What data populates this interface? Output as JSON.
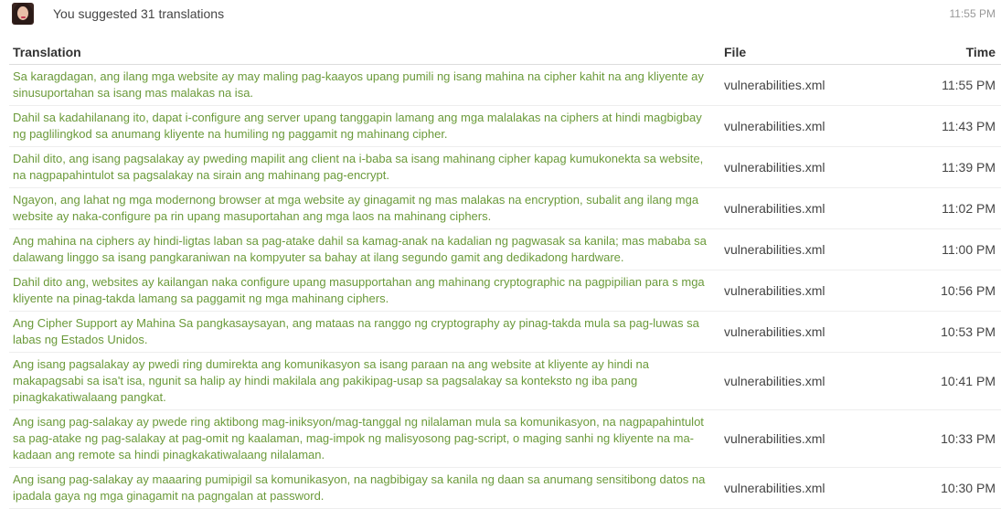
{
  "header": {
    "summary": "You suggested 31 translations",
    "time": "11:55 PM"
  },
  "table": {
    "columns": [
      "Translation",
      "File",
      "Time"
    ],
    "rows": [
      {
        "translation": "Sa karagdagan, ang ilang mga website ay may maling pag-kaayos upang pumili ng isang mahina na cipher kahit na ang kliyente ay sinusuportahan sa isang mas malakas na isa.",
        "file": "vulnerabilities.xml",
        "time": "11:55 PM"
      },
      {
        "translation": "Dahil sa kadahilanang ito, dapat i-configure ang server upang tanggapin lamang ang mga malalakas na ciphers at hindi magbigbay ng paglilingkod sa anumang kliyente na humiling ng paggamit ng mahinang cipher.",
        "file": "vulnerabilities.xml",
        "time": "11:43 PM"
      },
      {
        "translation": "Dahil dito, ang isang pagsalakay ay pweding mapilit ang client na i-baba sa isang mahinang cipher kapag kumukonekta sa website, na nagpapahintulot sa pagsalakay na sirain ang mahinang pag-encrypt.",
        "file": "vulnerabilities.xml",
        "time": "11:39 PM"
      },
      {
        "translation": "Ngayon, ang lahat ng mga modernong browser at mga website ay ginagamit ng mas malakas na encryption, subalit ang ilang mga website ay naka-configure pa rin upang masuportahan ang mga laos na mahinang ciphers.",
        "file": "vulnerabilities.xml",
        "time": "11:02 PM"
      },
      {
        "translation": "Ang mahina na ciphers ay hindi-ligtas laban sa pag-atake dahil sa kamag-anak na kadalian ng pagwasak sa kanila; mas mababa sa dalawang linggo sa isang pangkaraniwan na kompyuter sa bahay at ilang segundo gamit ang dedikadong hardware.",
        "file": "vulnerabilities.xml",
        "time": "11:00 PM"
      },
      {
        "translation": "Dahil dito ang, websites ay kailangan naka configure upang masupportahan ang mahinang cryptographic na pagpipilian para s mga kliyente na pinag-takda lamang sa paggamit ng mga mahinang ciphers.",
        "file": "vulnerabilities.xml",
        "time": "10:56 PM"
      },
      {
        "translation": "Ang Cipher Support ay Mahina Sa pangkasaysayan, ang mataas na ranggo ng cryptography ay pinag-takda mula sa pag-luwas sa labas ng Estados Unidos.",
        "file": "vulnerabilities.xml",
        "time": "10:53 PM"
      },
      {
        "translation": "Ang isang pagsalakay ay pwedi ring dumirekta ang komunikasyon sa isang paraan na ang website at kliyente ay hindi na makapagsabi sa isa't isa, ngunit sa halip ay hindi makilala ang pakikipag-usap sa pagsalakay sa konteksto ng iba pang pinagkakatiwalaang pangkat.",
        "file": "vulnerabilities.xml",
        "time": "10:41 PM"
      },
      {
        "translation": "Ang isang pag-salakay ay pwede ring aktibong mag-iniksyon/mag-tanggal ng nilalaman mula sa komunikasyon, na nagpapahintulot sa pag-atake ng pag-salakay at pag-omit ng kaalaman, mag-impok ng malisyosong pag-script, o maging sanhi ng kliyente na ma-kadaan ang remote sa hindi pinagkakatiwalaang nilalaman.",
        "file": "vulnerabilities.xml",
        "time": "10:33 PM"
      },
      {
        "translation": "Ang isang pag-salakay ay maaaring pumipigil sa komunikasyon, na nagbibigay sa kanila ng daan sa anumang sensitibong datos na ipadala gaya ng mga ginagamit na pagngalan at password.",
        "file": "vulnerabilities.xml",
        "time": "10:30 PM"
      }
    ]
  }
}
